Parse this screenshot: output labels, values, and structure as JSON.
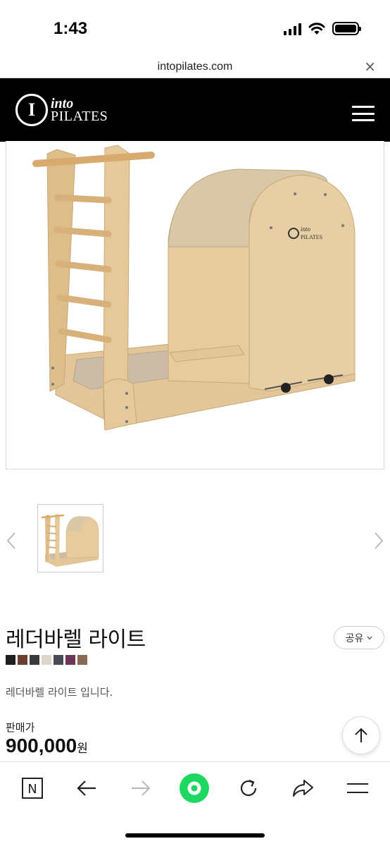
{
  "status_bar": {
    "time": "1:43"
  },
  "url_bar": {
    "url": "intopilates.com",
    "close_label": "×"
  },
  "header": {
    "logo_into": "into",
    "logo_pilates": "PILATES",
    "logo_mark": "I"
  },
  "product": {
    "name": "레더바렐 라이트",
    "share_label": "공유",
    "swatches": [
      "#1f1f1f",
      "#6b3e2e",
      "#3a3a3a",
      "#ddd5c8",
      "#4b4b55",
      "#6e3556",
      "#8a6a55"
    ],
    "description": "레더바렐 라이트 입니다.",
    "price_label": "판매가",
    "price": "900,000",
    "price_unit": "원"
  },
  "colors": {
    "header_bg": "#000000",
    "accent_green": "#1ed760",
    "wood": "#dcb989",
    "leather": "#d8c8a8"
  },
  "icons": [
    "wifi-icon",
    "close-icon",
    "hamburger-menu-icon",
    "chevron-left-icon",
    "chevron-right-icon",
    "chevron-down-icon",
    "arrow-up-icon",
    "naver-n-icon",
    "back-arrow-icon",
    "forward-arrow-icon",
    "green-dot-icon",
    "refresh-icon",
    "share-arrow-icon",
    "menu-lines-icon"
  ]
}
